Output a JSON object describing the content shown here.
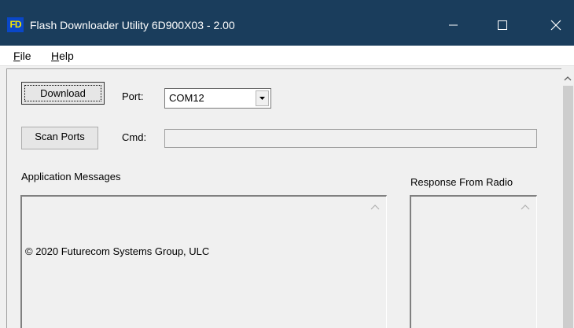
{
  "window": {
    "title": "Flash Downloader Utility 6D900X03 - 2.00",
    "logo_text": "FD"
  },
  "menu": {
    "file": {
      "letter": "F",
      "rest": "ile"
    },
    "help": {
      "letter": "H",
      "rest": "elp"
    }
  },
  "controls": {
    "download_label": "Download",
    "scan_label": "Scan Ports",
    "port_label": "Port:",
    "port_value": "COM12",
    "cmd_label": "Cmd:",
    "cmd_value": ""
  },
  "panels": {
    "messages_title": "Application Messages",
    "messages_text": "© 2020 Futurecom Systems Group, ULC",
    "response_title": "Response From Radio",
    "response_text": ""
  },
  "colors": {
    "titlebar": "#1a3d5c",
    "logo_bg": "#0a47c8",
    "logo_fg": "#f5e600"
  }
}
